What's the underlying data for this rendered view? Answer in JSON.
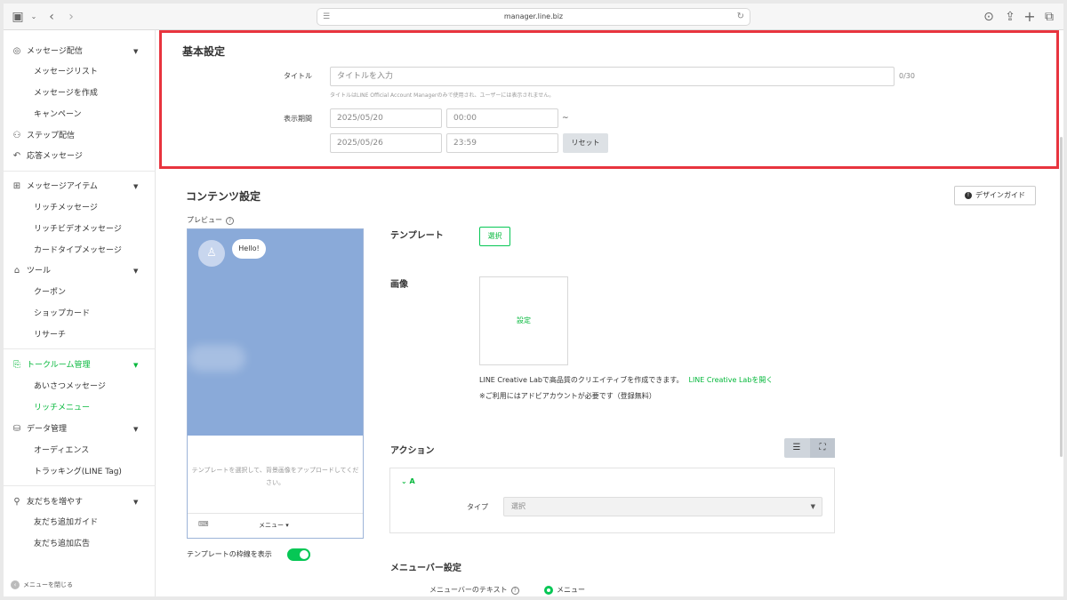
{
  "browser": {
    "url": "manager.line.biz"
  },
  "sidebar": {
    "sections": [
      {
        "icon": "broadcast-icon",
        "label": "メッセージ配信",
        "subs": [
          "メッセージリスト",
          "メッセージを作成",
          "キャンペーン"
        ]
      },
      {
        "icon": "step-icon",
        "label": "ステップ配信",
        "subs": []
      },
      {
        "icon": "reply-icon",
        "label": "応答メッセージ",
        "subs": []
      },
      {
        "icon": "message-item-icon",
        "label": "メッセージアイテム",
        "subs": [
          "リッチメッセージ",
          "リッチビデオメッセージ",
          "カードタイプメッセージ"
        ]
      },
      {
        "icon": "tools-icon",
        "label": "ツール",
        "subs": [
          "クーポン",
          "ショップカード",
          "リサーチ"
        ]
      },
      {
        "icon": "chatroom-icon",
        "label": "トークルーム管理",
        "subs": [
          "あいさつメッセージ",
          "リッチメニュー"
        ]
      },
      {
        "icon": "data-icon",
        "label": "データ管理",
        "subs": [
          "オーディエンス",
          "トラッキング(LINE Tag)"
        ]
      },
      {
        "icon": "add-friend-icon",
        "label": "友だちを増やす",
        "subs": [
          "友だち追加ガイド",
          "友だち追加広告"
        ]
      }
    ],
    "footer": "メニューを閉じる",
    "active_section": "トークルーム管理",
    "active_item": "リッチメニュー"
  },
  "basic": {
    "heading": "基本設定",
    "title_label": "タイトル",
    "title_placeholder": "タイトルを入力",
    "title_counter": "0/30",
    "title_hint": "タイトルはLINE Official Account Managerのみで使用され、ユーザーには表示されません。",
    "period_label": "表示期間",
    "start_date": "2025/05/20",
    "start_time": "00:00",
    "tilde": "~",
    "end_date": "2025/05/26",
    "end_time": "23:59",
    "reset_label": "リセット"
  },
  "content": {
    "heading": "コンテンツ設定",
    "design_guide": "デザインガイド",
    "preview_label": "プレビュー",
    "bubble": "Hello!",
    "preview_msg": "テンプレートを選択して、背景画像をアップロードしてください。",
    "menu_label": "メニュー ▾",
    "frame_toggle_label": "テンプレートの枠線を表示",
    "frame_toggle_on": true,
    "template_label": "テンプレート",
    "select_label": "選択",
    "image_label": "画像",
    "image_set": "設定",
    "lab_text": "LINE Creative Labで高品質のクリエイティブを作成できます。",
    "lab_link": "LINE Creative Labを開く",
    "lab_note": "※ご利用にはアドビアカウントが必要です（登録無料）",
    "action_label": "アクション",
    "action_a": "A",
    "type_label": "タイプ",
    "type_value": "選択",
    "menubar_heading": "メニューバー設定",
    "menubar_text_label": "メニューバーのテキスト",
    "menubar_radio": "メニュー"
  },
  "colors": {
    "accent": "#06c755",
    "highlight": "#e8343e"
  }
}
